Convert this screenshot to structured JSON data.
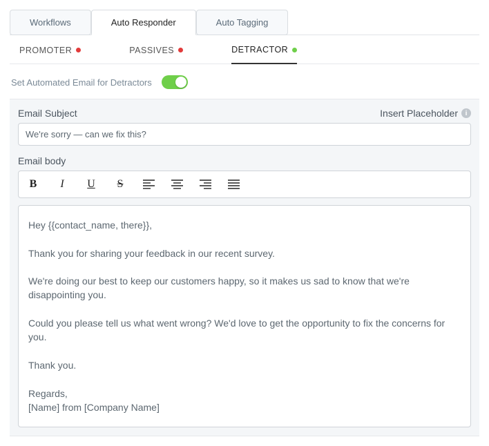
{
  "top_tabs": {
    "workflows": "Workflows",
    "auto_responder": "Auto Responder",
    "auto_tagging": "Auto Tagging",
    "active": "auto_responder"
  },
  "sub_tabs": {
    "promoter": "PROMOTER",
    "passives": "PASSIVES",
    "detractor": "DETRACTOR",
    "active": "detractor"
  },
  "toggle_label": "Set Automated Email for Detractors",
  "toggle_on": true,
  "subject_label": "Email Subject",
  "insert_placeholder_label": "Insert Placeholder",
  "subject_value": "We're sorry — can we fix this?",
  "body_label": "Email body",
  "body_content": "Hey {{contact_name, there}},\n\nThank you for sharing your feedback in our recent survey.\n\nWe're doing our best to keep our customers happy, so it makes us sad to know that we're disappointing you.\n\nCould you please tell us what went wrong? We'd love to get the opportunity to fix the concerns for you.\n\nThank you.\n\nRegards,\n[Name] from [Company Name]"
}
